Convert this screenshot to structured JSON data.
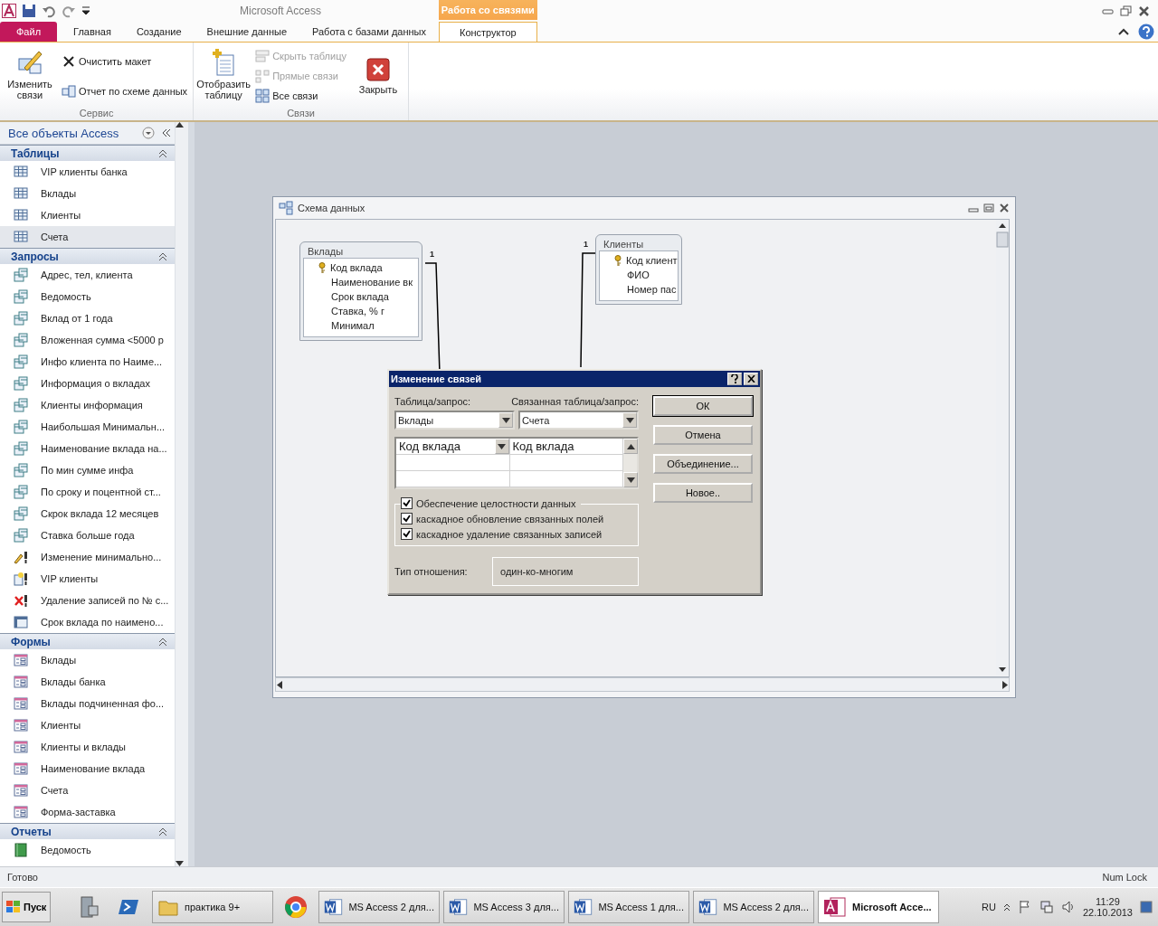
{
  "app": {
    "title": "Microsoft Access",
    "context_group": "Работа со связями"
  },
  "tabs": [
    {
      "label": "Файл",
      "kind": "file",
      "selected": false
    },
    {
      "label": "Главная",
      "kind": "normal",
      "selected": false
    },
    {
      "label": "Создание",
      "kind": "normal",
      "selected": false
    },
    {
      "label": "Внешние данные",
      "kind": "normal",
      "selected": false
    },
    {
      "label": "Работа с базами данных",
      "kind": "normal",
      "selected": false
    },
    {
      "label": "Конструктор",
      "kind": "context",
      "selected": true
    }
  ],
  "ribbon": {
    "groups": [
      {
        "label": "Сервис",
        "large": [
          {
            "label": "Изменить связи",
            "kind": "edit"
          }
        ],
        "small": [
          {
            "label": "Очистить макет",
            "kind": "clear",
            "disabled": false
          },
          {
            "label": "Отчет по схеме данных",
            "kind": "report",
            "disabled": false
          }
        ]
      },
      {
        "label": "Связи",
        "large": [
          {
            "label": "Отобразить таблицу",
            "kind": "show"
          }
        ],
        "small": [
          {
            "label": "Скрыть таблицу",
            "kind": "hide",
            "disabled": true
          },
          {
            "label": "Прямые связи",
            "kind": "direct",
            "disabled": true
          },
          {
            "label": "Все связи",
            "kind": "all",
            "disabled": false
          }
        ],
        "after": [
          {
            "label": "Закрыть",
            "kind": "close"
          }
        ]
      }
    ]
  },
  "nav": {
    "title": "Все объекты Access",
    "sections": [
      {
        "label": "Таблицы",
        "items": [
          {
            "label": "VIP клиенты банка",
            "kind": "table",
            "selected": false
          },
          {
            "label": "Вклады",
            "kind": "table",
            "selected": false
          },
          {
            "label": "Клиенты",
            "kind": "table",
            "selected": false
          },
          {
            "label": "Счета",
            "kind": "table",
            "selected": true
          }
        ]
      },
      {
        "label": "Запросы",
        "items": [
          {
            "label": "Адрес, тел, клиента",
            "kind": "query",
            "selected": false
          },
          {
            "label": "Ведомость",
            "kind": "query",
            "selected": false
          },
          {
            "label": "Вклад от 1 года",
            "kind": "query",
            "selected": false
          },
          {
            "label": "Вложенная сумма <5000 р",
            "kind": "query",
            "selected": false
          },
          {
            "label": "Инфо клиента по Наиме...",
            "kind": "query",
            "selected": false
          },
          {
            "label": "Информация о вкладах",
            "kind": "query",
            "selected": false
          },
          {
            "label": "Клиенты информация",
            "kind": "query",
            "selected": false
          },
          {
            "label": "Наибольшая Минимальн...",
            "kind": "query",
            "selected": false
          },
          {
            "label": "Наименование вклада на...",
            "kind": "query",
            "selected": false
          },
          {
            "label": "По мин сумме инфа",
            "kind": "query",
            "selected": false
          },
          {
            "label": "По сроку и поцентной ст...",
            "kind": "query",
            "selected": false
          },
          {
            "label": "Скрок вклада 12 месяцев",
            "kind": "query",
            "selected": false
          },
          {
            "label": "Ставка больше года",
            "kind": "query",
            "selected": false
          },
          {
            "label": "Изменение минимально...",
            "kind": "update",
            "selected": false
          },
          {
            "label": "VIP клиенты",
            "kind": "maketable",
            "selected": false
          },
          {
            "label": "Удаление записей по № с...",
            "kind": "delete",
            "selected": false
          },
          {
            "label": "Срок вклада по наимено...",
            "kind": "crosstab",
            "selected": false
          }
        ]
      },
      {
        "label": "Формы",
        "items": [
          {
            "label": "Вклады",
            "kind": "form",
            "selected": false
          },
          {
            "label": "Вклады банка",
            "kind": "form",
            "selected": false
          },
          {
            "label": "Вклады подчиненная фо...",
            "kind": "form",
            "selected": false
          },
          {
            "label": "Клиенты",
            "kind": "form",
            "selected": false
          },
          {
            "label": "Клиенты и вклады",
            "kind": "form",
            "selected": false
          },
          {
            "label": "Наименование вклада",
            "kind": "form",
            "selected": false
          },
          {
            "label": "Счета",
            "kind": "form",
            "selected": false
          },
          {
            "label": "Форма-заставка",
            "kind": "form",
            "selected": false
          }
        ]
      },
      {
        "label": "Отчеты",
        "items": [
          {
            "label": "Ведомость",
            "kind": "report",
            "selected": false
          }
        ]
      }
    ]
  },
  "schema": {
    "title": "Схема данных",
    "tables": [
      {
        "name": "Вклады",
        "fields": [
          {
            "name": "Код вклада",
            "key": true
          },
          {
            "name": "Наименование вк",
            "key": false
          },
          {
            "name": "Срок вклада",
            "key": false
          },
          {
            "name": "Ставка, % г",
            "key": false
          },
          {
            "name": "Минимал",
            "key": false
          }
        ]
      },
      {
        "name": "Клиенты",
        "fields": [
          {
            "name": "Код клиент",
            "key": true
          },
          {
            "name": "ФИО",
            "key": false
          },
          {
            "name": "Номер пас",
            "key": false
          }
        ]
      }
    ],
    "relations": [
      {
        "label": "1"
      },
      {
        "label": "1"
      }
    ]
  },
  "dialog": {
    "title": "Изменение связей",
    "table_label": "Таблица/запрос:",
    "related_label": "Связанная таблица/запрос:",
    "table": "Вклады",
    "related": "Счета",
    "pairs": [
      {
        "left": "Код вклада",
        "right": "Код вклада"
      }
    ],
    "options": [
      {
        "label": "Обеспечение целостности данных",
        "checked": true
      },
      {
        "label": "каскадное обновление связанных полей",
        "checked": true
      },
      {
        "label": "каскадное удаление связанных записей",
        "checked": true
      }
    ],
    "type_label": "Тип отношения:",
    "type_value": "один-ко-многим",
    "buttons": [
      {
        "label": "ОК",
        "default": true
      },
      {
        "label": "Отмена",
        "default": false
      },
      {
        "label": "Объединение...",
        "default": false
      },
      {
        "label": "Новое..",
        "default": false
      }
    ]
  },
  "status_bar": {
    "left": "Готово",
    "right": "Num Lock"
  },
  "taskbar": {
    "start": "Пуск",
    "buttons": [
      {
        "label": "практика 9+",
        "kind": "folder",
        "selected": false
      },
      {
        "label": "MS Access 2 для...",
        "kind": "word",
        "selected": false
      },
      {
        "label": "MS Access 3 для...",
        "kind": "word",
        "selected": false
      },
      {
        "label": "MS Access 1 для...",
        "kind": "word",
        "selected": false
      },
      {
        "label": "MS Access 2 для...",
        "kind": "word",
        "selected": false
      },
      {
        "label": "Microsoft Acce...",
        "kind": "access",
        "selected": true
      }
    ],
    "lang": "RU",
    "time": "11:29",
    "date": "22.10.2013"
  }
}
